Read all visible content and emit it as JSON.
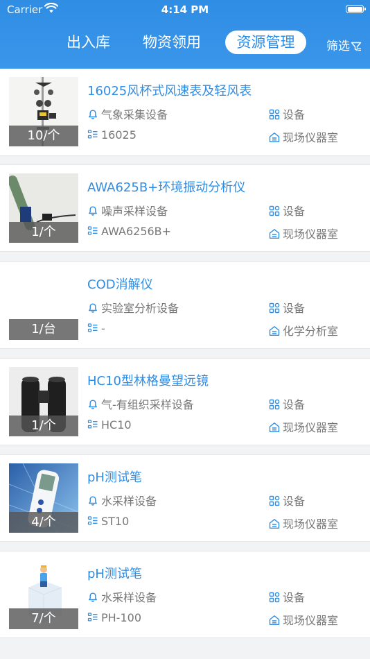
{
  "status_bar": {
    "carrier": "Carrier",
    "time": "4:14 PM"
  },
  "tabs": [
    {
      "label": "出入库"
    },
    {
      "label": "物资领用"
    },
    {
      "label": "资源管理",
      "active": true
    }
  ],
  "filter_label": "筛选",
  "accent_color": "#2f8de4",
  "items": [
    {
      "title": "16025风杯式风速表及轻风表",
      "qty": "10/个",
      "category": "气象采集设备",
      "type": "设备",
      "model": "16025",
      "location": "现场仪器室",
      "image": "anemometer"
    },
    {
      "title": "AWA625B+环境振动分析仪",
      "qty": "1/个",
      "category": "噪声采样设备",
      "type": "设备",
      "model": "AWA6256B+",
      "location": "现场仪器室",
      "image": "vibration-analyzer"
    },
    {
      "title": "COD消解仪",
      "qty": "1/台",
      "category": "实验室分析设备",
      "type": "设备",
      "model": "-",
      "location": "化学分析室",
      "image": ""
    },
    {
      "title": "HC10型林格曼望远镜",
      "qty": "1/个",
      "category": "气-有组织采样设备",
      "type": "设备",
      "model": "HC10",
      "location": "现场仪器室",
      "image": "binoculars"
    },
    {
      "title": "pH测试笔",
      "qty": "4/个",
      "category": "水采样设备",
      "type": "设备",
      "model": "ST10",
      "location": "现场仪器室",
      "image": "ph-pen"
    },
    {
      "title": "pH测试笔",
      "qty": "7/个",
      "category": "水采样设备",
      "type": "设备",
      "model": "PH-100",
      "location": "现场仪器室",
      "image": "placeholder"
    }
  ]
}
